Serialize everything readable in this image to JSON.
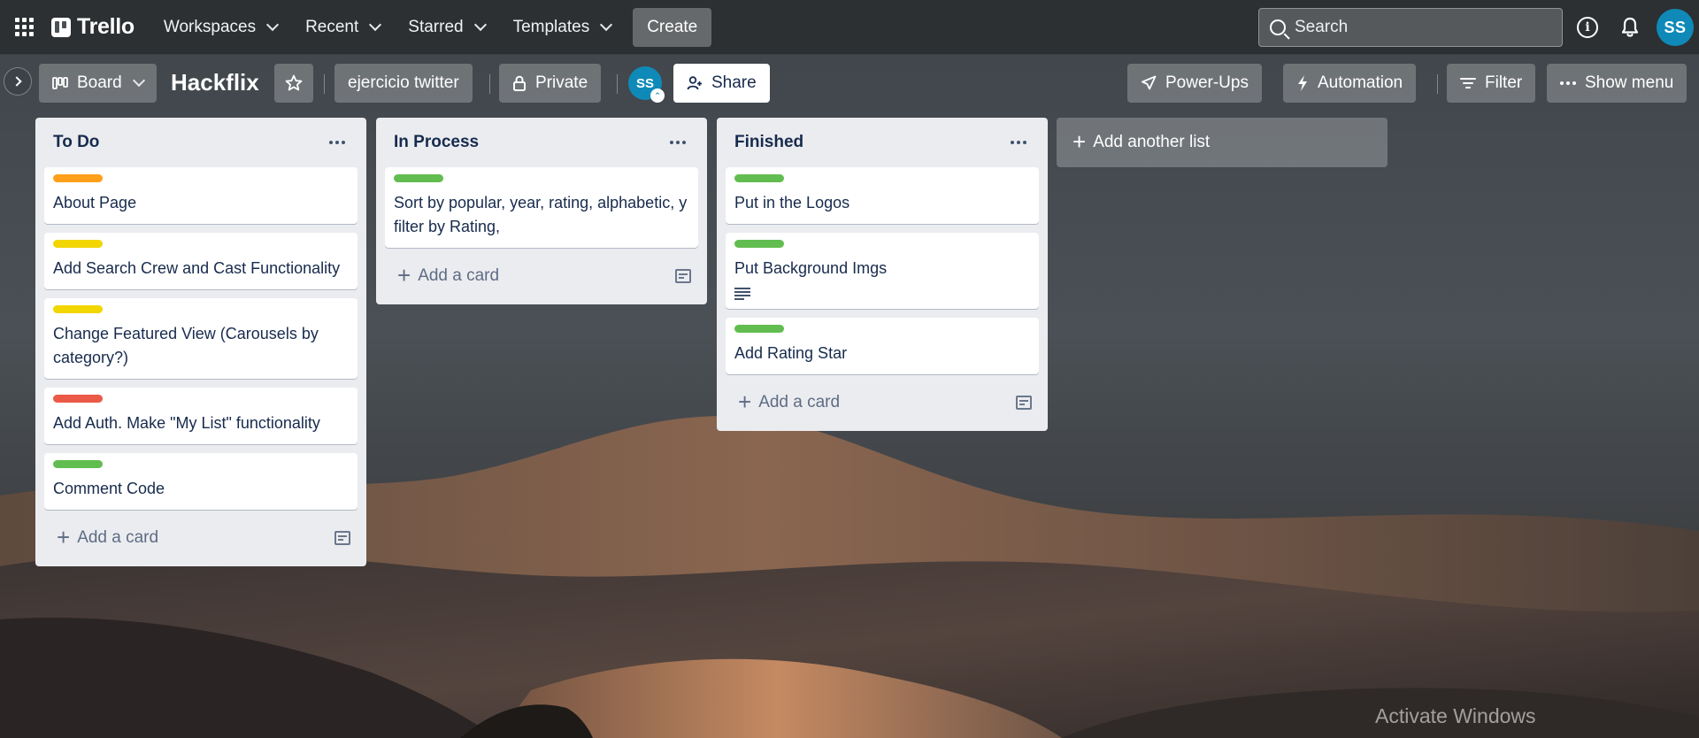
{
  "topnav": {
    "logo": "Trello",
    "menu": [
      {
        "label": "Workspaces"
      },
      {
        "label": "Recent"
      },
      {
        "label": "Starred"
      },
      {
        "label": "Templates"
      }
    ],
    "create_label": "Create",
    "search_placeholder": "Search",
    "user_initials": "SS"
  },
  "board": {
    "view_label": "Board",
    "title": "Hackflix",
    "workspace_label": "ejercicio twitter",
    "visibility_label": "Private",
    "member_initials": "SS",
    "share_label": "Share",
    "powerups_label": "Power-Ups",
    "automation_label": "Automation",
    "filter_label": "Filter",
    "menu_label": "Show menu"
  },
  "lists": [
    {
      "title": "To Do",
      "cards": [
        {
          "label_color": "#ff9f1a",
          "text": "About Page"
        },
        {
          "label_color": "#f2d600",
          "text": "Add Search Crew and Cast Functionality"
        },
        {
          "label_color": "#f2d600",
          "text": "Change Featured View (Carousels by category?)"
        },
        {
          "label_color": "#eb5a46",
          "text": "Add Auth. Make \"My List\" functionality"
        },
        {
          "label_color": "#61bd4f",
          "text": "Comment Code"
        }
      ],
      "add_card_label": "Add a card"
    },
    {
      "title": "In Process",
      "cards": [
        {
          "label_color": "#61bd4f",
          "text": "Sort by popular, year, rating, alphabetic, y filter by Rating,"
        }
      ],
      "add_card_label": "Add a card"
    },
    {
      "title": "Finished",
      "cards": [
        {
          "label_color": "#61bd4f",
          "text": "Put in the Logos"
        },
        {
          "label_color": "#61bd4f",
          "text": "Put Background Imgs",
          "has_description": true
        },
        {
          "label_color": "#61bd4f",
          "text": "Add Rating Star"
        }
      ],
      "add_card_label": "Add a card"
    }
  ],
  "add_list_label": "Add another list",
  "watermark": "Activate Windows"
}
